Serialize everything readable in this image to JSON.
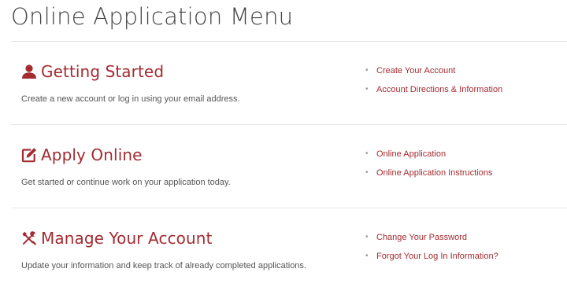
{
  "page": {
    "title": "Online Application Menu"
  },
  "colors": {
    "accent": "#a32b31",
    "text": "#555555",
    "divider": "#e2e6e9"
  },
  "sections": [
    {
      "icon": "user-icon",
      "heading": "Getting Started",
      "description": "Create a new account or log in using your email address.",
      "links": [
        {
          "bullet": "•",
          "label": "Create Your Account"
        },
        {
          "bullet": "•",
          "label": "Account Directions & Information"
        }
      ]
    },
    {
      "icon": "edit-icon",
      "heading": "Apply Online",
      "description": "Get started or continue work on your application today.",
      "links": [
        {
          "bullet": "•",
          "label": "Online Application"
        },
        {
          "bullet": "•",
          "label": "Online Application Instructions"
        }
      ]
    },
    {
      "icon": "tools-icon",
      "heading": "Manage Your Account",
      "description": "Update your information and keep track of already completed applications.",
      "links": [
        {
          "bullet": "•",
          "label": "Change Your Password"
        },
        {
          "bullet": "•",
          "label": "Forgot Your Log In Information?"
        }
      ]
    }
  ]
}
